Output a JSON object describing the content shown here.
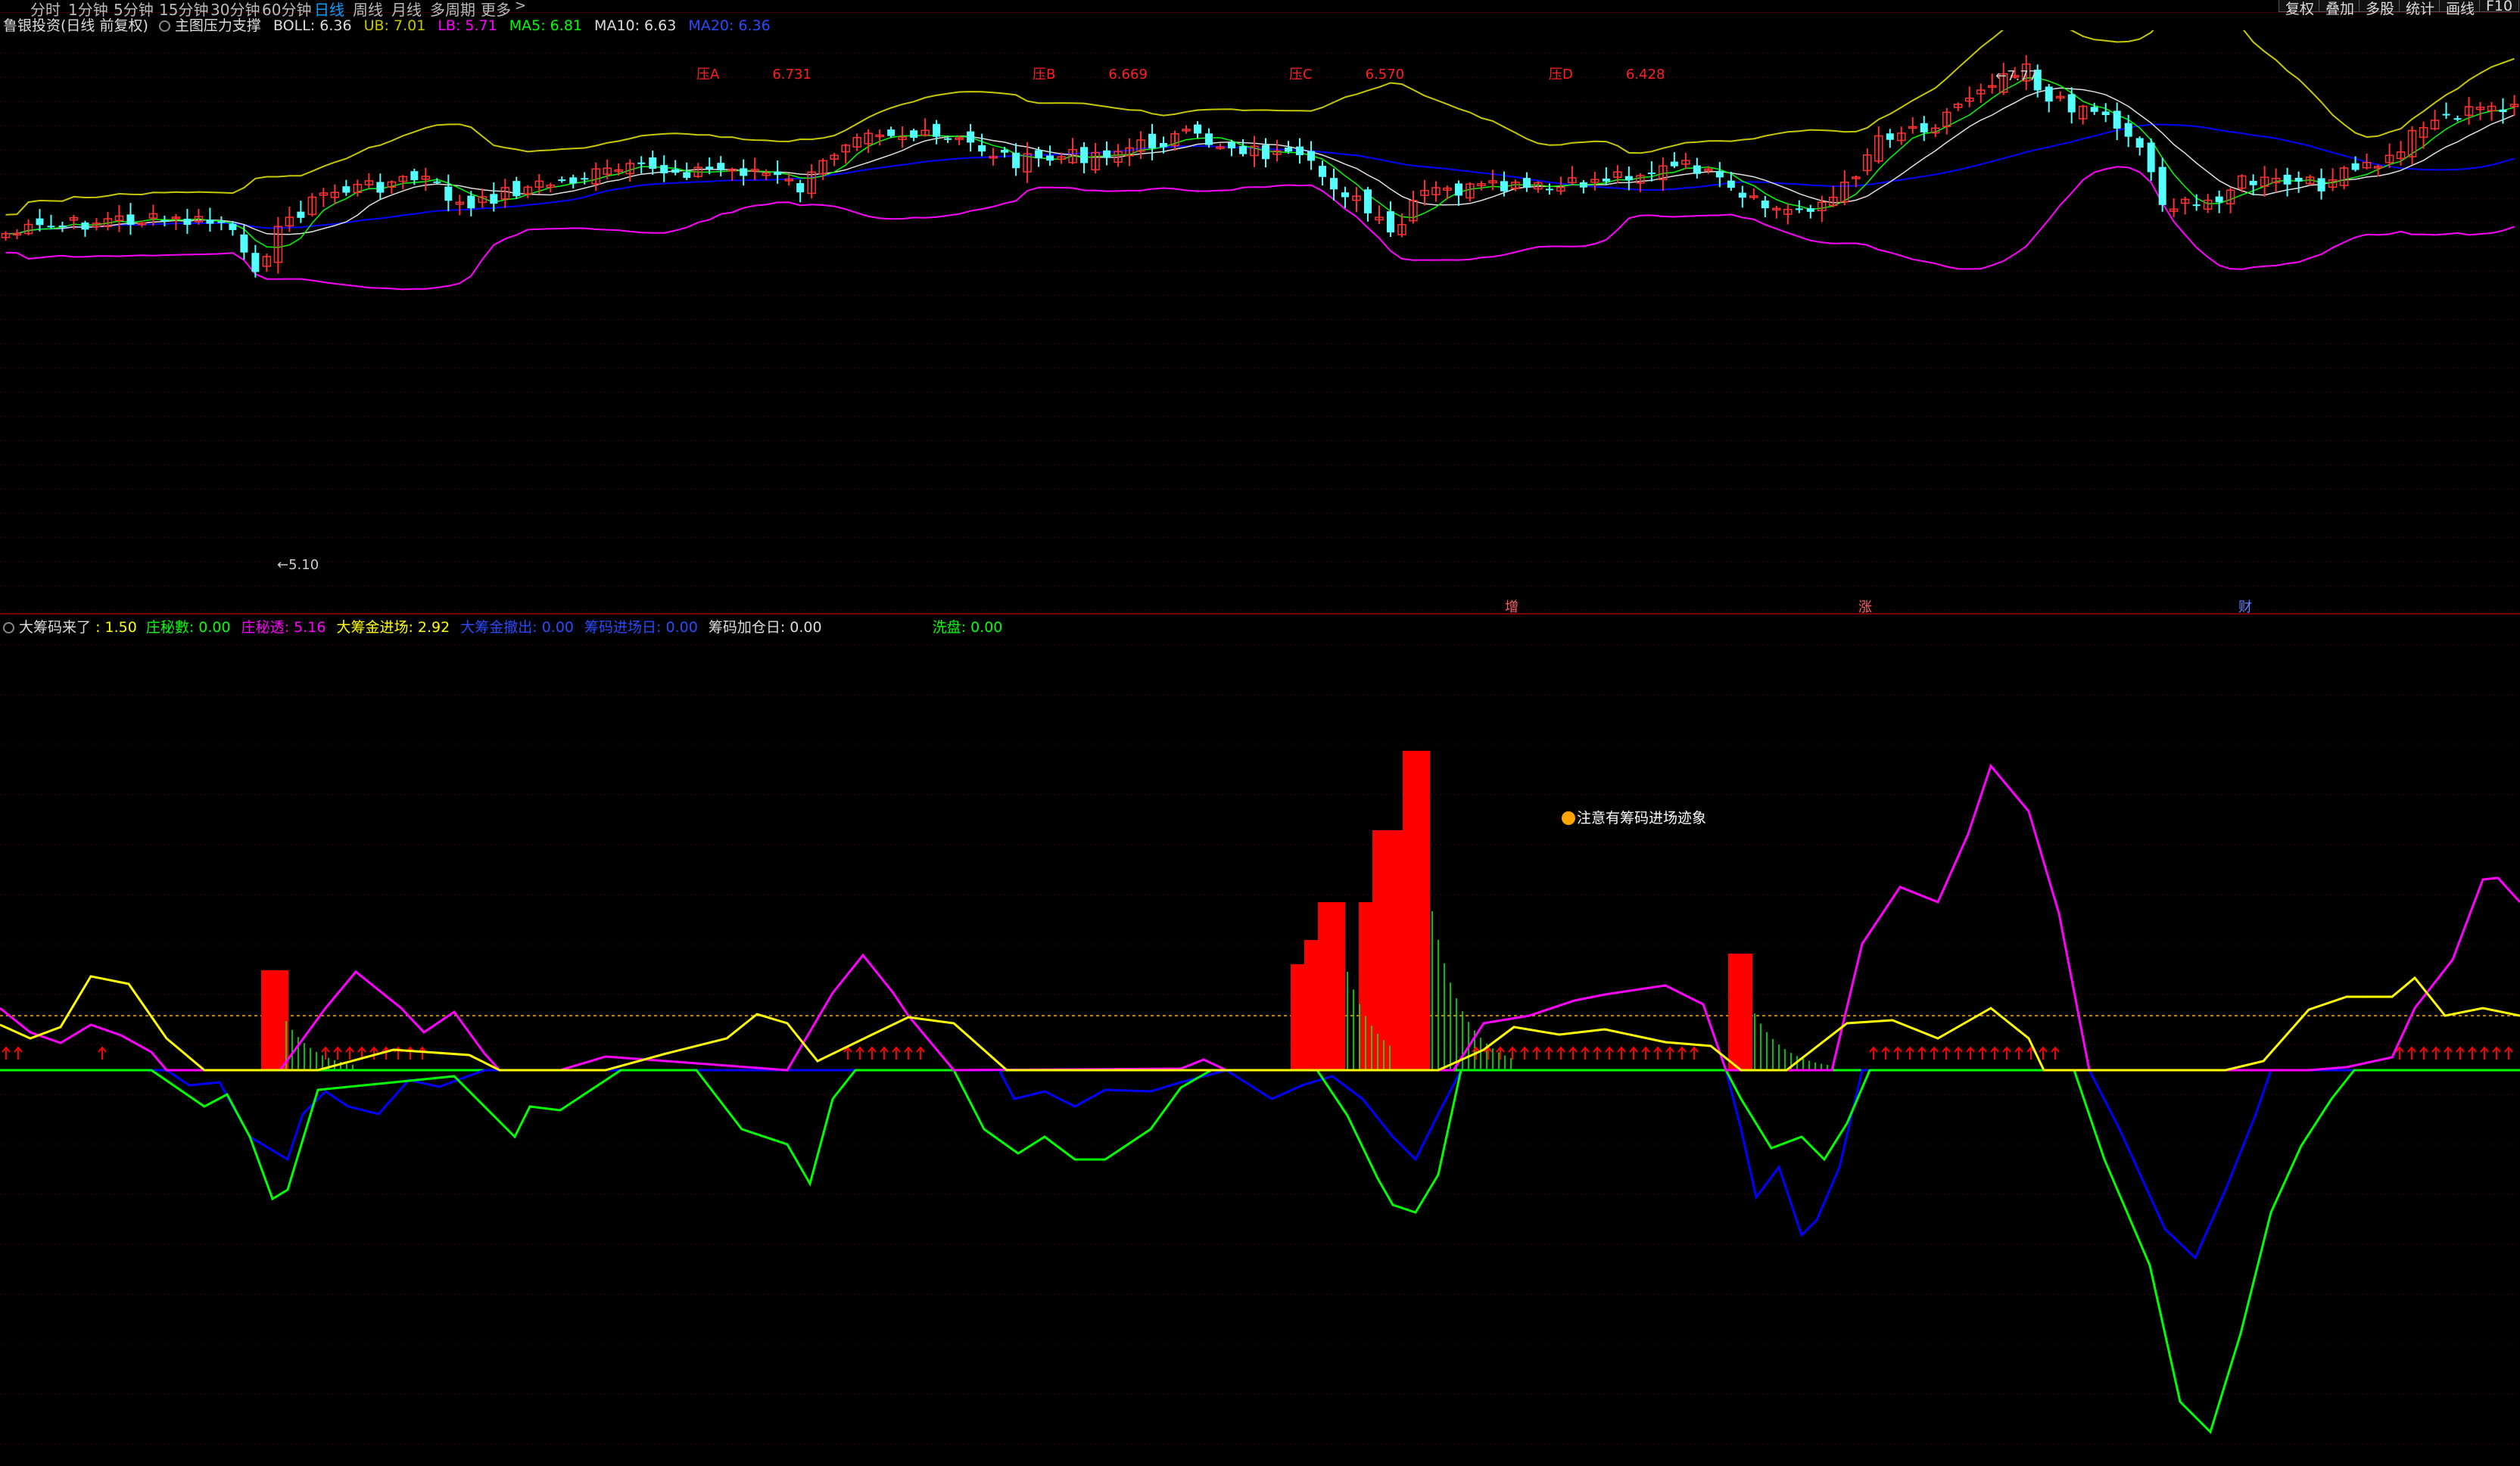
{
  "toolbar": {
    "periods": [
      "分时",
      "1分钟",
      "5分钟",
      "15分钟",
      "30分钟",
      "60分钟",
      "日线",
      "周线",
      "月线",
      "多周期",
      "更多"
    ],
    "active_period": "日线",
    "right_buttons": [
      "复权",
      "叠加",
      "多股",
      "统计",
      "画线",
      "F10"
    ]
  },
  "main_legend": {
    "stock": "鲁银投资(日线 前复权)",
    "indicator": "主图压力支撑",
    "boll": "BOLL: 6.36",
    "ub": "UB: 7.01",
    "lb": "LB: 5.71",
    "ma5": "MA5: 6.81",
    "ma10": "MA10: 6.63",
    "ma20": "MA20: 6.36"
  },
  "pressure_labels": [
    {
      "name": "压A",
      "value": "6.731"
    },
    {
      "name": "压B",
      "value": "6.669"
    },
    {
      "name": "压C",
      "value": "6.570"
    },
    {
      "name": "压D",
      "value": "6.428"
    }
  ],
  "price_marks": {
    "high": "7.77",
    "low": "5.10"
  },
  "bottom_signals": [
    "增",
    "涨",
    "财"
  ],
  "sub_legend": {
    "title": "大筹码来了",
    "v1": ": 1.50",
    "v2": "庄秘數: 0.00",
    "v3": "庄秘透: 5.16",
    "v4": "大筹金进场: 2.92",
    "v5": "大筹金撤出: 0.00",
    "v6": "筹码进场日: 0.00",
    "v7": "筹码加仓日: 0.00",
    "v8": "洗盘: 0.00"
  },
  "annotation": "注意有筹码进场迹象",
  "colors": {
    "up": "#ff3232",
    "down": "#54ffff",
    "ub": "#c8c800",
    "lb": "#ff00ff",
    "mid": "#e0e0e0",
    "ma5": "#00ff00",
    "ma20": "#0000ff",
    "yellow": "#ffff00",
    "magenta": "#ff00ff",
    "green": "#00ff00",
    "blue": "#0000ff",
    "red_bar": "#ff0000"
  }
}
